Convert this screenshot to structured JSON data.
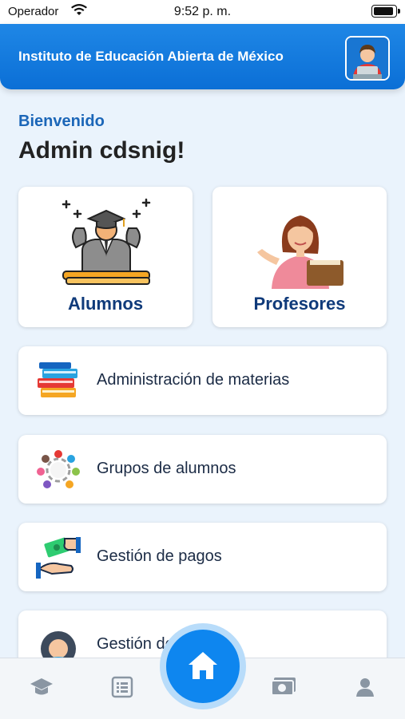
{
  "status_bar": {
    "carrier": "Operador",
    "time": "9:52 p. m."
  },
  "header": {
    "title": "Instituto de Educación Abierta de México"
  },
  "greeting": {
    "welcome": "Bienvenido",
    "user": "Admin cdsnig!"
  },
  "tiles": [
    {
      "label": "Alumnos"
    },
    {
      "label": "Profesores"
    }
  ],
  "menu": [
    {
      "label": "Administración de materias"
    },
    {
      "label": "Grupos de alumnos"
    },
    {
      "label": "Gestión de pagos"
    },
    {
      "label": "Gestión de usuarios"
    }
  ],
  "nav": {
    "items": [
      "graduation-cap-icon",
      "list-icon",
      "home-icon",
      "money-icon",
      "user-icon"
    ],
    "active": "home"
  },
  "colors": {
    "header": "#0b6fd6",
    "accent": "#0e86ef",
    "title_text": "#0f3a7a",
    "welcome_text": "#1b66b8",
    "background": "#eaf3fc"
  }
}
